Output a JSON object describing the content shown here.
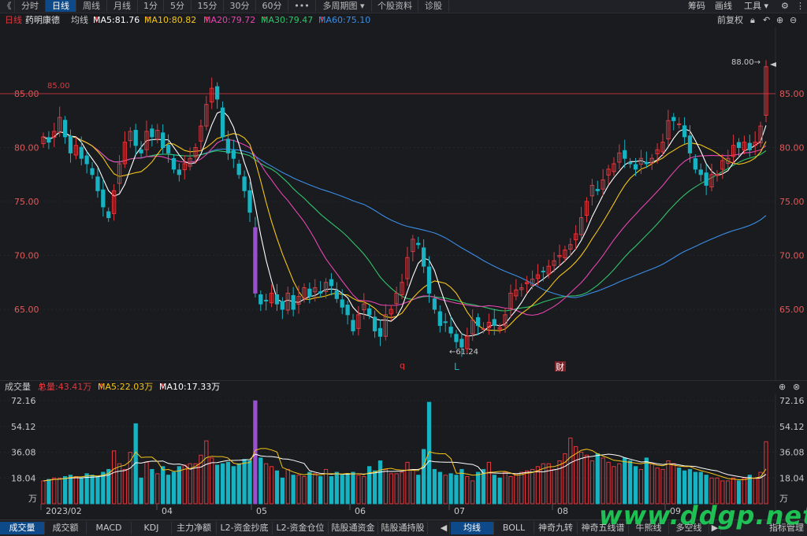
{
  "topbar": {
    "back_glyph": "《",
    "tabs": [
      "分时",
      "日线",
      "周线",
      "月线",
      "1分",
      "5分",
      "15分",
      "30分",
      "60分"
    ],
    "active_tab": "日线",
    "more": "•••",
    "multi_period": "多周期图",
    "stock_info": "个股资料",
    "diagnose": "诊股",
    "right": [
      "筹码",
      "画线",
      "工具"
    ]
  },
  "ma_bar": {
    "period": "日线",
    "name": "药明康德",
    "label": "均线",
    "ma5": "MA5:81.76",
    "ma10": "MA10:80.82",
    "ma20": "MA20:79.72",
    "ma30": "MA30:79.47",
    "ma60": "MA60:75.10",
    "adjust": "前复权",
    "colors": {
      "ma5": "#ffffff",
      "ma10": "#f5c518",
      "ma20": "#e545b0",
      "ma30": "#2fc46a",
      "ma60": "#3a8ee6"
    }
  },
  "price_axis": {
    "ticks": [
      "85.00",
      "80.00",
      "75.00",
      "70.00",
      "65.00"
    ],
    "values": [
      85,
      80,
      75,
      70,
      65
    ]
  },
  "annotations": {
    "hline_label": "85.00",
    "high_label": "88.00→",
    "low_label": "←61.24",
    "markers": [
      "q",
      "L",
      "财"
    ]
  },
  "vol_bar": {
    "title": "成交量",
    "total": "总量:43.41万",
    "ma5": "MA5:22.03万",
    "ma10": "MA10:17.33万"
  },
  "vol_axis": {
    "ticks": [
      "72.16",
      "54.12",
      "36.08",
      "18.04"
    ],
    "values": [
      72.16,
      54.12,
      36.08,
      18.04
    ],
    "unit": "万"
  },
  "x_axis": {
    "labels": [
      "2023/02",
      "04",
      "05",
      "06",
      "07",
      "08",
      "09"
    ]
  },
  "bottom_tabs_left": [
    "成交量",
    "成交额",
    "MACD",
    "KDJ",
    "主力净额",
    "L2-资金抄底",
    "L2-资金仓位",
    "陆股通资金",
    "陆股通持股"
  ],
  "bottom_tabs_right": [
    "均线",
    "BOLL",
    "神奇九转",
    "神奇五线谱",
    "牛熊线",
    "多空线"
  ],
  "bottom_right": "指标管理",
  "watermark": "www.ddgp.net",
  "chart_data": {
    "type": "candlestick",
    "title": "药明康德 日线",
    "up_color": "#e0383e",
    "down_color": "#17b3c2",
    "ylim": [
      61,
      89
    ],
    "close": [
      81,
      80.5,
      81.5,
      82.8,
      81,
      79.5,
      80.2,
      79,
      78.5,
      77.5,
      76,
      74.5,
      73.5,
      76,
      78.5,
      80.5,
      81.5,
      80.2,
      79.5,
      81.5,
      81,
      81.6,
      80,
      79.5,
      78,
      77.5,
      78.5,
      79,
      80,
      82,
      84,
      85.5,
      84.5,
      81,
      79.5,
      79,
      77.5,
      76,
      74,
      66.5,
      65.5,
      65.8,
      66.5,
      65.5,
      65,
      66.5,
      65,
      66.2,
      67,
      66.2,
      67,
      66.5,
      67.5,
      67.2,
      66,
      65.2,
      64.5,
      63,
      64.5,
      65.5,
      64.5,
      63,
      62.5,
      64.5,
      65,
      66.5,
      67.5,
      69.8,
      71.5,
      71,
      69,
      66.5,
      65,
      63.5,
      63.8,
      62.8,
      62,
      61.5,
      62.5,
      64,
      63.5,
      63.2,
      63.8,
      63.5,
      63.3,
      64.5,
      66.5,
      66.8,
      67,
      67.5,
      67.8,
      68.2,
      68.5,
      69,
      69.5,
      70,
      70.5,
      71,
      72,
      73.5,
      75,
      76.5,
      76,
      77,
      78,
      78.5,
      79.5,
      79,
      78.5,
      78,
      79,
      78.5,
      79,
      79.8,
      80.5,
      82.5,
      82.5,
      82.2,
      81,
      79.5,
      78,
      77.5,
      76.5,
      77.5,
      77.5,
      78.8,
      79,
      80.2,
      80,
      80.5,
      79.8,
      80.5,
      82,
      87.5
    ],
    "volume": [
      16,
      17,
      18,
      18,
      19,
      20,
      19,
      18,
      21,
      20,
      19,
      22,
      24,
      37,
      28,
      24,
      36,
      56,
      18,
      29,
      24,
      21,
      26,
      20,
      22,
      26,
      27,
      28,
      28,
      34,
      44,
      32,
      27,
      28,
      29,
      26,
      28,
      31,
      30,
      72,
      32,
      28,
      26,
      23,
      18,
      24,
      20,
      20,
      19,
      22,
      21,
      19,
      24,
      19,
      22,
      20,
      21,
      22,
      20,
      19,
      26,
      23,
      30,
      24,
      21,
      21,
      22,
      29,
      24,
      20,
      38,
      71,
      24,
      22,
      20,
      21,
      20,
      24,
      19,
      16,
      22,
      24,
      29,
      20,
      18,
      22,
      19,
      21,
      22,
      23,
      24,
      26,
      28,
      28,
      24,
      30,
      35,
      46,
      40,
      36,
      34,
      30,
      35,
      32,
      29,
      26,
      28,
      32,
      30,
      26,
      24,
      32,
      28,
      25,
      24,
      30,
      28,
      25,
      23,
      24,
      22,
      22,
      20,
      18,
      18,
      16,
      16,
      18,
      16,
      18,
      20,
      18,
      22,
      43.41
    ],
    "ma5_last": 81.76,
    "ma10_last": 80.82,
    "ma20_last": 79.72,
    "ma30_last": 79.47,
    "ma60_last": 75.1,
    "vol_ma5_last": 22.03,
    "vol_ma10_last": 17.33,
    "high": 88.0,
    "low": 61.24
  }
}
